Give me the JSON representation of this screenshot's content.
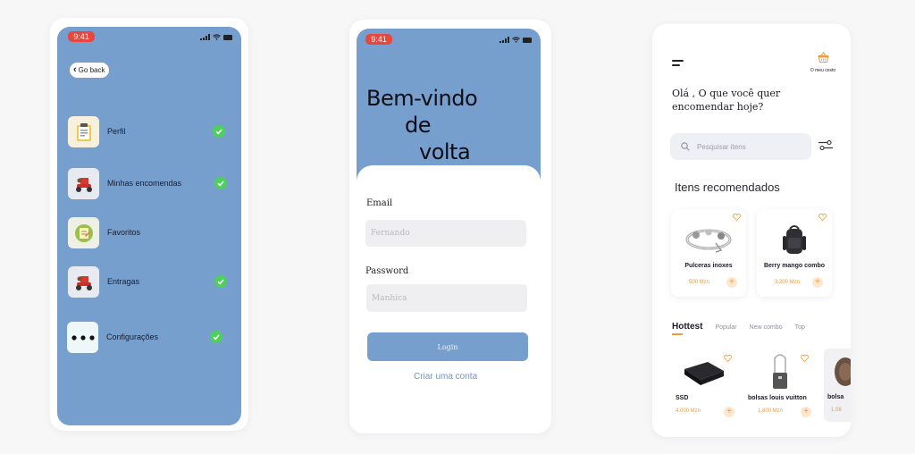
{
  "phone1": {
    "status_time": "9:41",
    "go_back": "Go back",
    "menu": [
      {
        "label": "Perfil",
        "checked": true
      },
      {
        "label": "Minhas encomendas",
        "checked": true
      },
      {
        "label": "Favoritos",
        "checked": false
      },
      {
        "label": "Entragas",
        "checked": true
      },
      {
        "label": "Configurações",
        "checked": true
      }
    ]
  },
  "phone2": {
    "status_time": "9:41",
    "welcome_line1": "Bem-vindo",
    "welcome_line2": "de",
    "welcome_line3": "volta",
    "email_label": "Email",
    "email_placeholder": "Fernando",
    "password_label": "Password",
    "password_placeholder": "Manhica",
    "login_label": "Login",
    "create_account": "Criar uma conta"
  },
  "phone3": {
    "cart_label": "O meu cesto",
    "greeting": "Olá , O que você quer encomendar hoje?",
    "search_placeholder": "Pesquisar itens",
    "recommended_title": "Itens recomendados",
    "recommended": [
      {
        "name": "Pulceras inoxes",
        "price": "500 Mzn"
      },
      {
        "name": "Berry mango combo",
        "price": "3.200 Mzn"
      }
    ],
    "tabs": [
      "Hottest",
      "Popular",
      "New combo",
      "Top"
    ],
    "hottest": [
      {
        "name": "SSD",
        "price": "4.000 Mzn"
      },
      {
        "name": "bolsas louis vuitton",
        "price": "1.800 Mzn"
      },
      {
        "name": "bolsa",
        "price": "1.08"
      }
    ]
  },
  "colors": {
    "screen_blue": "#779fce",
    "accent_orange": "#f09a3e",
    "check_green": "#4fcf5b",
    "status_red": "#e8463f"
  }
}
